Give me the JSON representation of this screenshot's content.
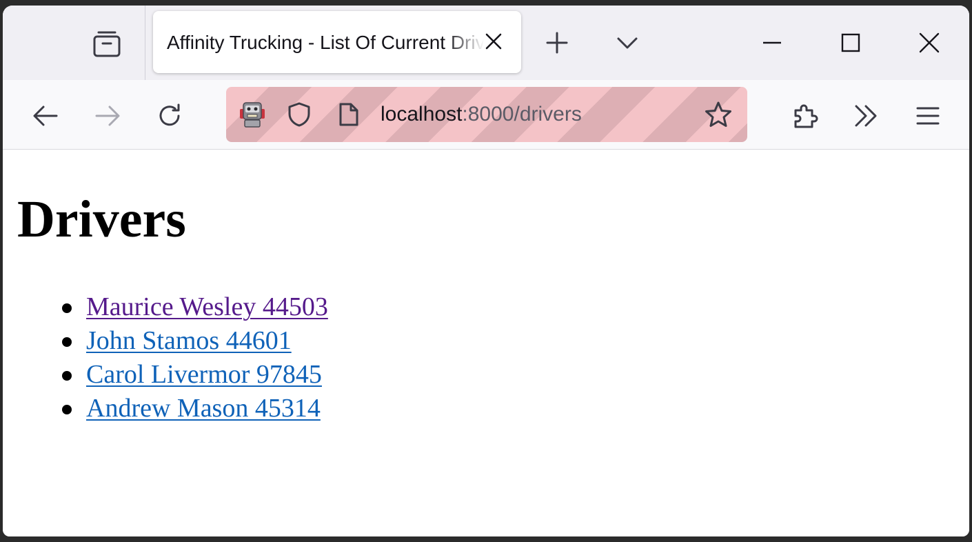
{
  "browser": {
    "tab": {
      "title": "Affinity Trucking - List Of Current Drivers"
    },
    "url": {
      "host": "localhost",
      "path": ":8000/drivers"
    }
  },
  "page": {
    "title": "Drivers",
    "drivers": [
      {
        "label": "Maurice Wesley 44503",
        "visited": true
      },
      {
        "label": "John Stamos 44601",
        "visited": false
      },
      {
        "label": "Carol Livermor 97845",
        "visited": false
      },
      {
        "label": "Andrew Mason 45314",
        "visited": false
      }
    ]
  },
  "colors": {
    "visited_link": "#551a8b",
    "unvisited_link": "#0f62b8",
    "private_urlbar": "#f4c3c7"
  }
}
